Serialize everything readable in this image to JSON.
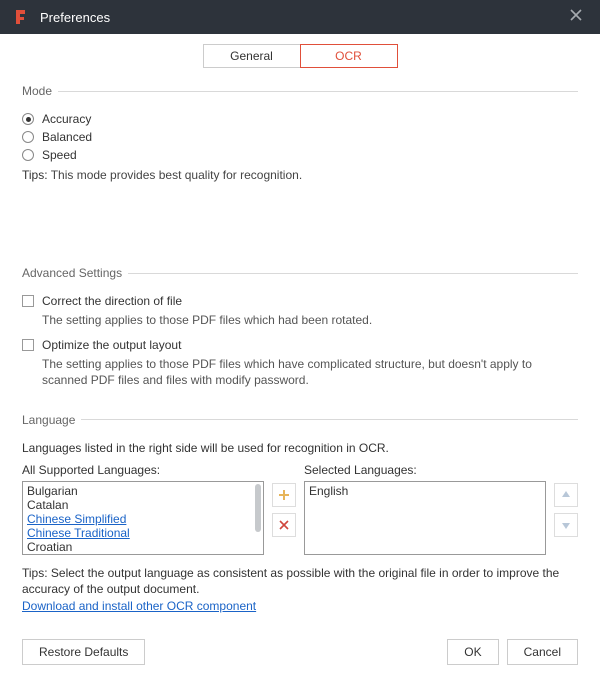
{
  "window": {
    "title": "Preferences"
  },
  "tabs": {
    "general": "General",
    "ocr": "OCR"
  },
  "mode": {
    "legend": "Mode",
    "options": {
      "accuracy": "Accuracy",
      "balanced": "Balanced",
      "speed": "Speed"
    },
    "tips_label": "Tips:",
    "tips_text": "This mode provides best quality for recognition."
  },
  "advanced": {
    "legend": "Advanced Settings",
    "correct_label": "Correct the direction of file",
    "correct_desc": "The setting applies to those PDF files which had been rotated.",
    "optimize_label": "Optimize the output layout",
    "optimize_desc": "The setting applies to those PDF files which have complicated structure, but doesn't apply to scanned PDF files and files with modify password."
  },
  "language": {
    "legend": "Language",
    "intro": "Languages listed in the right side will be used for recognition in OCR.",
    "all_header": "All Supported Languages:",
    "selected_header": "Selected Languages:",
    "all_items": [
      "Bulgarian",
      "Catalan",
      "Chinese Simplified",
      "Chinese Traditional",
      "Croatian"
    ],
    "all_link_flags": [
      false,
      false,
      true,
      true,
      false
    ],
    "selected_items": [
      "English"
    ],
    "tips_label": "Tips:",
    "tips_text": "Select the output language as consistent as possible with the original file in order to improve the accuracy of the output document.",
    "download_link": "Download and install other OCR component"
  },
  "footer": {
    "restore": "Restore Defaults",
    "ok": "OK",
    "cancel": "Cancel"
  }
}
